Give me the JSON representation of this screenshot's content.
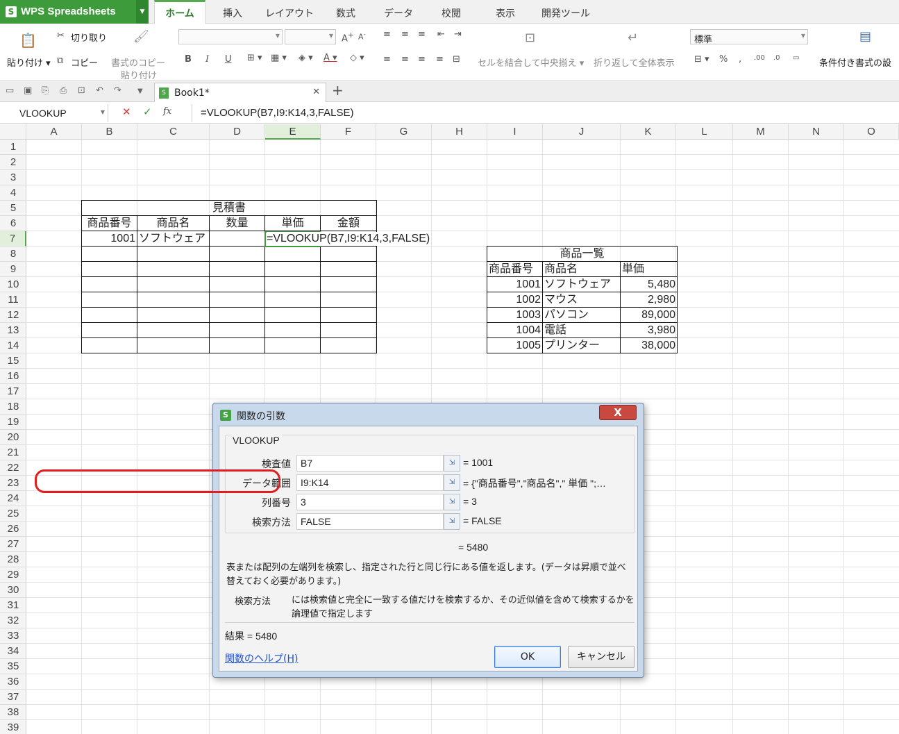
{
  "app": {
    "name": "WPS Spreadsheets",
    "logo": "S"
  },
  "ribbon_tabs": [
    "ホーム",
    "挿入",
    "レイアウト",
    "数式",
    "データ",
    "校閲",
    "表示",
    "開発ツール"
  ],
  "ribbon": {
    "paste": "貼り付け",
    "cut": "切り取り",
    "copy": "コピー",
    "format_painter_1": "書式のコピー",
    "format_painter_2": "貼り付け",
    "merge_center": "セルを結合して中央揃え",
    "wrap_text": "折り返して全体表示",
    "number_format": "標準",
    "conditional_format": "条件付き書式の設"
  },
  "doc_tab": {
    "name": "Book1*"
  },
  "formula_bar": {
    "name_box": "VLOOKUP",
    "formula": "=VLOOKUP(B7,I9:K14,3,FALSE)"
  },
  "columns": [
    "A",
    "B",
    "C",
    "D",
    "E",
    "F",
    "G",
    "H",
    "I",
    "J",
    "K",
    "L",
    "M",
    "N",
    "O"
  ],
  "rows": [
    "1",
    "2",
    "3",
    "4",
    "5",
    "6",
    "7",
    "8",
    "9",
    "10",
    "11",
    "12",
    "13",
    "14",
    "15",
    "16",
    "17",
    "18",
    "19",
    "20",
    "21",
    "22",
    "23",
    "24",
    "25",
    "26",
    "27",
    "28",
    "29",
    "30",
    "31",
    "32",
    "33",
    "34",
    "35",
    "36",
    "37",
    "38",
    "39"
  ],
  "quote_table": {
    "title": "見積書",
    "headers": [
      "商品番号",
      "商品名",
      "数量",
      "単価",
      "金額"
    ],
    "row1": {
      "code": "1001",
      "name": "ソフトウェア",
      "editing": "=VLOOKUP(B7,I9:K14,3,FALSE)"
    }
  },
  "product_table": {
    "title": "商品一覧",
    "headers": [
      "商品番号",
      "商品名",
      "単価"
    ],
    "rows": [
      {
        "code": "1001",
        "name": "ソフトウェア",
        "price": "5,480"
      },
      {
        "code": "1002",
        "name": "マウス",
        "price": "2,980"
      },
      {
        "code": "1003",
        "name": "パソコン",
        "price": "89,000"
      },
      {
        "code": "1004",
        "name": "電話",
        "price": "3,980"
      },
      {
        "code": "1005",
        "name": "プリンター",
        "price": "38,000"
      }
    ]
  },
  "dialog": {
    "title": "関数の引数",
    "close": "X",
    "function_name": "VLOOKUP",
    "args": [
      {
        "label": "検査値",
        "value": "B7",
        "result": "= 1001"
      },
      {
        "label": "データ範囲",
        "value": "I9:K14",
        "result": "= {\"商品番号\",\"商品名\",\" 単価 \";…"
      },
      {
        "label": "列番号",
        "value": "3",
        "result": "= 3"
      },
      {
        "label": "検索方法",
        "value": "FALSE",
        "result": "= FALSE"
      }
    ],
    "total": "= 5480",
    "description": "表または配列の左端列を検索し、指定された行と同じ行にある値を返します。(データは昇順で並べ替えておく必要があります。)",
    "arg_help_label": "検索方法",
    "arg_help": "には検索値と完全に一致する値だけを検索するか、その近似値を含めて検索するかを論理値で指定します",
    "result": "結果 = 5480",
    "help_link": "関数のヘルプ(H)",
    "ok": "OK",
    "cancel": "キャンセル"
  },
  "colors": {
    "accent_green": "#3d9b3b",
    "highlight_red": "#e21d1d",
    "link_blue": "#1a4fd6"
  }
}
